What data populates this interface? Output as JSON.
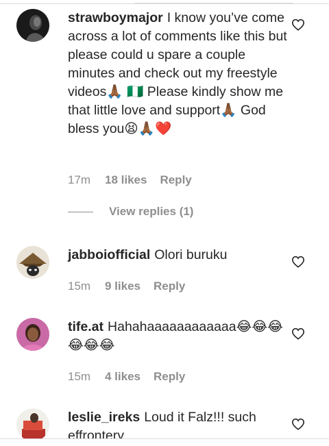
{
  "comments": [
    {
      "username": "strawboymajor",
      "text": "I know you’ve come across a lot of comments like this but please could u spare a couple minutes and check out my freestyle videos🙏🏾 🇳🇬 Please kindly show me that little love and support🙏🏾 God bless you😫🙏🏾❤️",
      "time": "17m",
      "likes": "18 likes",
      "reply": "Reply"
    },
    {
      "username": "jabboiofficial",
      "text": "Olori buruku",
      "time": "15m",
      "likes": "9 likes",
      "reply": "Reply"
    },
    {
      "username": "tife.at",
      "text": "Hahahaaaaaaaaaaaa😂😂😂😂😂😂",
      "time": "15m",
      "likes": "4 likes",
      "reply": "Reply"
    },
    {
      "username": "leslie_ireks",
      "text": "Loud it Falz!!! such effrontery",
      "time": "",
      "likes": "",
      "reply": ""
    }
  ],
  "view_replies": "View replies (1)",
  "colors": {
    "text": "#262626",
    "meta": "#8e8e8e",
    "divider": "#dbdbdb"
  },
  "icons": [
    "heart-outline-icon"
  ]
}
